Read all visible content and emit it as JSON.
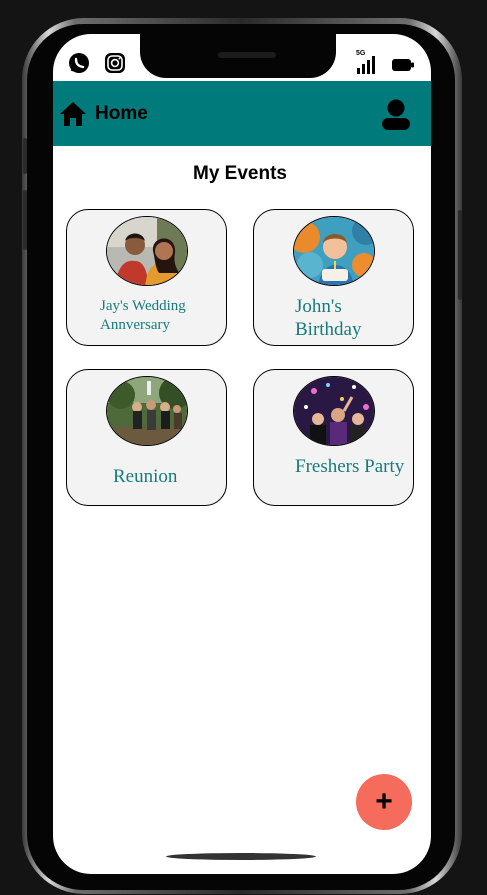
{
  "status_bar": {
    "left_icons": [
      "whatsapp-icon",
      "instagram-icon"
    ],
    "network_label": "5G",
    "right_icons": [
      "signal-icon",
      "battery-icon"
    ]
  },
  "app_bar": {
    "title": "Home",
    "background": "#007a7a",
    "icons": [
      "home-icon",
      "user-icon"
    ]
  },
  "page": {
    "title": "My Events"
  },
  "events": [
    {
      "label": "Jay's Wedding Annversary",
      "thumbnail": "couple-photo"
    },
    {
      "label": "John's Birthday",
      "thumbnail": "birthday-boy-photo"
    },
    {
      "label": "Reunion",
      "thumbnail": "group-outdoor-photo"
    },
    {
      "label": "Freshers Party",
      "thumbnail": "party-crowd-photo"
    }
  ],
  "fab": {
    "symbol": "+",
    "color": "#f56b5c"
  },
  "theme": {
    "accent": "#177b7b",
    "card_background": "#f3f3f3"
  }
}
